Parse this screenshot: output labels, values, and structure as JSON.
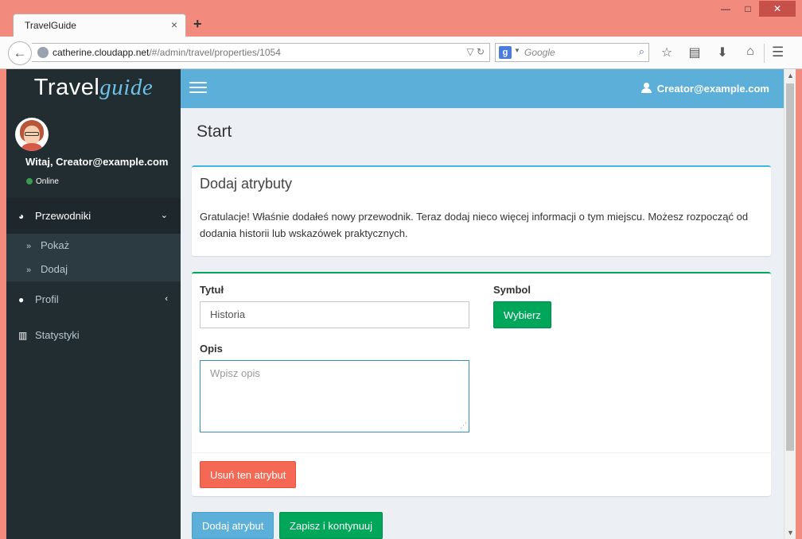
{
  "browser": {
    "tab_title": "TravelGuide",
    "tab_close": "×",
    "new_tab": "+",
    "url_host": "catherine.cloudapp.net",
    "url_path": "/#/admin/travel/properties/1054",
    "search_placeholder": "Google",
    "search_engine_icon": "g",
    "window_controls": {
      "minimize": "—",
      "maximize": "□",
      "close": "✕"
    },
    "icons": [
      "back-icon",
      "reload-icon",
      "star-icon",
      "reading-list-icon",
      "download-icon",
      "home-icon",
      "menu-icon"
    ]
  },
  "sidebar": {
    "logo": {
      "part1": "Travel",
      "part2": "guide"
    },
    "greeting": "Witaj, Creator@example.com",
    "status": "Online",
    "menu": [
      {
        "label": "Przewodniki",
        "icon": "dashboard-icon",
        "arrow": "⌄",
        "active": true
      },
      {
        "label": "Profil",
        "icon": "user-icon",
        "arrow": "‹",
        "active": false
      },
      {
        "label": "Statystyki",
        "icon": "bar-chart-icon",
        "arrow": "",
        "active": false
      }
    ],
    "submenu": [
      {
        "label": "Pokaż",
        "icon": "»"
      },
      {
        "label": "Dodaj",
        "icon": "»"
      }
    ]
  },
  "header": {
    "user": "Creator@example.com"
  },
  "content": {
    "page_title": "Start",
    "info_box": {
      "title": "Dodaj atrybuty",
      "text": "Gratulacje! Właśnie dodałeś nowy przewodnik. Teraz dodaj nieco więcej informacji o tym miejscu. Możesz rozpocząć od dodania historii lub wskazówek praktycznych."
    },
    "form": {
      "title_label": "Tytuł",
      "title_value": "Historia",
      "symbol_label": "Symbol",
      "symbol_button": "Wybierz",
      "description_label": "Opis",
      "description_placeholder": "Wpisz opis",
      "remove_button": "Usuń ten atrybut"
    },
    "actions": {
      "add_attribute": "Dodaj atrybut",
      "save_continue": "Zapisz i kontynuuj"
    }
  },
  "colors": {
    "browser_frame": "#f28b7d",
    "sidebar": "#222d32",
    "header": "#5bafd9",
    "green": "#00a65a",
    "red": "#f56954",
    "info_border": "#3fb5e0"
  }
}
